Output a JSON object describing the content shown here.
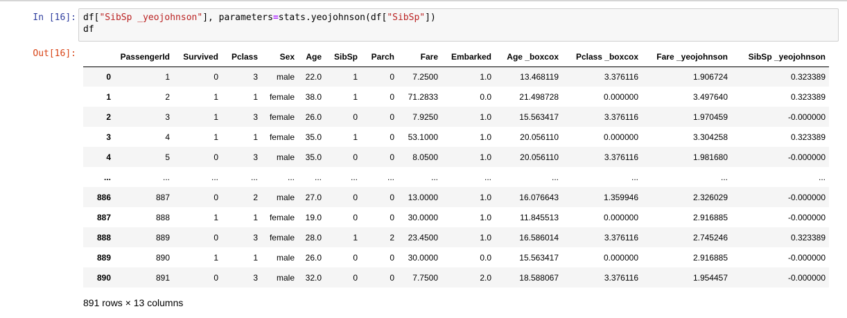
{
  "cell": {
    "in_prompt": "In [16]:",
    "out_prompt": "Out[16]:",
    "code_line1": {
      "a": "df[",
      "s1": "\"SibSp _yeojohnson\"",
      "b": "], parameters",
      "eq": "=",
      "c": "stats.yeojohnson(df[",
      "s2": "\"SibSp\"",
      "d": "])"
    },
    "code_line2": "df"
  },
  "table": {
    "columns": [
      "",
      "PassengerId",
      "Survived",
      "Pclass",
      "Sex",
      "Age",
      "SibSp",
      "Parch",
      "Fare",
      "Embarked",
      "Age _boxcox",
      "Pclass _boxcox",
      "Fare _yeojohnson",
      "SibSp _yeojohnson"
    ],
    "rows": [
      [
        "0",
        "1",
        "0",
        "3",
        "male",
        "22.0",
        "1",
        "0",
        "7.2500",
        "1.0",
        "13.468119",
        "3.376116",
        "1.906724",
        "0.323389"
      ],
      [
        "1",
        "2",
        "1",
        "1",
        "female",
        "38.0",
        "1",
        "0",
        "71.2833",
        "0.0",
        "21.498728",
        "0.000000",
        "3.497640",
        "0.323389"
      ],
      [
        "2",
        "3",
        "1",
        "3",
        "female",
        "26.0",
        "0",
        "0",
        "7.9250",
        "1.0",
        "15.563417",
        "3.376116",
        "1.970459",
        "-0.000000"
      ],
      [
        "3",
        "4",
        "1",
        "1",
        "female",
        "35.0",
        "1",
        "0",
        "53.1000",
        "1.0",
        "20.056110",
        "0.000000",
        "3.304258",
        "0.323389"
      ],
      [
        "4",
        "5",
        "0",
        "3",
        "male",
        "35.0",
        "0",
        "0",
        "8.0500",
        "1.0",
        "20.056110",
        "3.376116",
        "1.981680",
        "-0.000000"
      ],
      [
        "...",
        "...",
        "...",
        "...",
        "...",
        "...",
        "...",
        "...",
        "...",
        "...",
        "...",
        "...",
        "...",
        "..."
      ],
      [
        "886",
        "887",
        "0",
        "2",
        "male",
        "27.0",
        "0",
        "0",
        "13.0000",
        "1.0",
        "16.076643",
        "1.359946",
        "2.326029",
        "-0.000000"
      ],
      [
        "887",
        "888",
        "1",
        "1",
        "female",
        "19.0",
        "0",
        "0",
        "30.0000",
        "1.0",
        "11.845513",
        "0.000000",
        "2.916885",
        "-0.000000"
      ],
      [
        "888",
        "889",
        "0",
        "3",
        "female",
        "28.0",
        "1",
        "2",
        "23.4500",
        "1.0",
        "16.586014",
        "3.376116",
        "2.745246",
        "0.323389"
      ],
      [
        "889",
        "890",
        "1",
        "1",
        "male",
        "26.0",
        "0",
        "0",
        "30.0000",
        "0.0",
        "15.563417",
        "0.000000",
        "2.916885",
        "-0.000000"
      ],
      [
        "890",
        "891",
        "0",
        "3",
        "male",
        "32.0",
        "0",
        "0",
        "7.7500",
        "2.0",
        "18.588067",
        "3.376116",
        "1.954457",
        "-0.000000"
      ]
    ]
  },
  "footer": "891 rows × 13 columns"
}
